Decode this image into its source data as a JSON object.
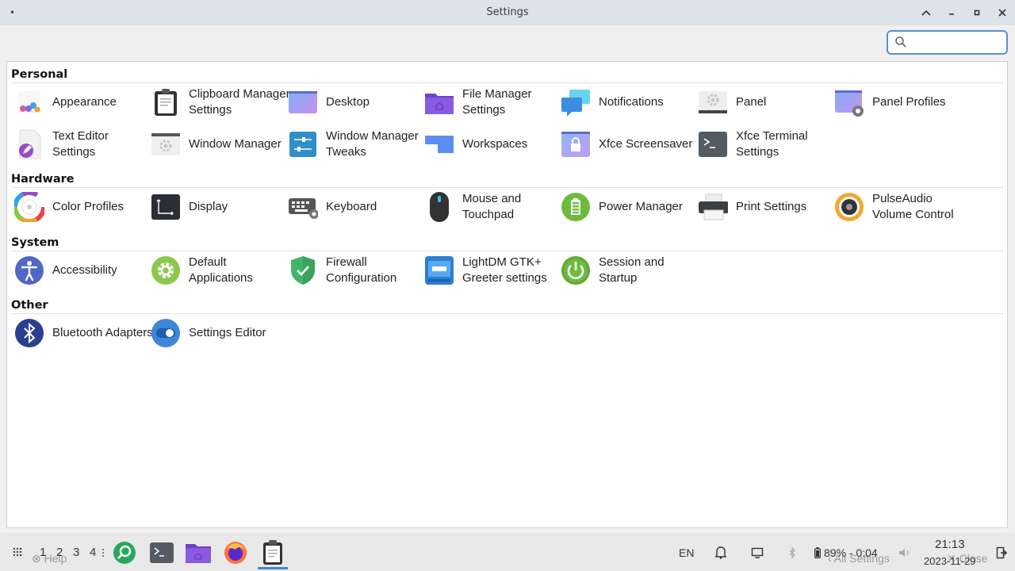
{
  "window": {
    "title": "Settings",
    "menu_glyph": "•"
  },
  "search": {
    "value": "",
    "placeholder": ""
  },
  "categories": [
    {
      "title": "Personal"
    },
    {
      "title": "Hardware"
    },
    {
      "title": "System"
    },
    {
      "title": "Other"
    }
  ],
  "items": {
    "appearance": {
      "label": "Appearance"
    },
    "clipboard": {
      "label": "Clipboard Manager Settings"
    },
    "desktop": {
      "label": "Desktop"
    },
    "file_manager": {
      "label": "File Manager Settings"
    },
    "notifications": {
      "label": "Notifications"
    },
    "panel": {
      "label": "Panel"
    },
    "panel_profiles": {
      "label": "Panel Profiles"
    },
    "text_editor": {
      "label": "Text Editor Settings"
    },
    "window_manager": {
      "label": "Window Manager"
    },
    "wm_tweaks": {
      "label": "Window Manager Tweaks"
    },
    "workspaces": {
      "label": "Workspaces"
    },
    "screensaver": {
      "label": "Xfce Screensaver"
    },
    "terminal": {
      "label": "Xfce Terminal Settings"
    },
    "color_profiles": {
      "label": "Color Profiles"
    },
    "display": {
      "label": "Display"
    },
    "keyboard": {
      "label": "Keyboard"
    },
    "mouse": {
      "label": "Mouse and Touchpad"
    },
    "power": {
      "label": "Power Manager"
    },
    "print": {
      "label": "Print Settings"
    },
    "pulseaudio": {
      "label": "PulseAudio Volume Control"
    },
    "accessibility": {
      "label": "Accessibility"
    },
    "default_apps": {
      "label": "Default Applications"
    },
    "firewall": {
      "label": "Firewall Configuration"
    },
    "lightdm": {
      "label": "LightDM GTK+ Greeter settings"
    },
    "session": {
      "label": "Session and Startup"
    },
    "bluetooth": {
      "label": "Bluetooth Adapters"
    },
    "settings_editor": {
      "label": "Settings Editor"
    }
  },
  "taskbar": {
    "workspaces": [
      "1",
      "2",
      "3",
      "4"
    ],
    "keyboard_layout": "EN",
    "battery": "89% - 0:04",
    "time": "21:13",
    "date": "2023-11-29",
    "hidden_help": "Help",
    "hidden_all_settings": "All Settings",
    "hidden_close": "Close"
  },
  "colors": {
    "accent": "#5b8fd0",
    "titlebar": "#dde3e9"
  }
}
